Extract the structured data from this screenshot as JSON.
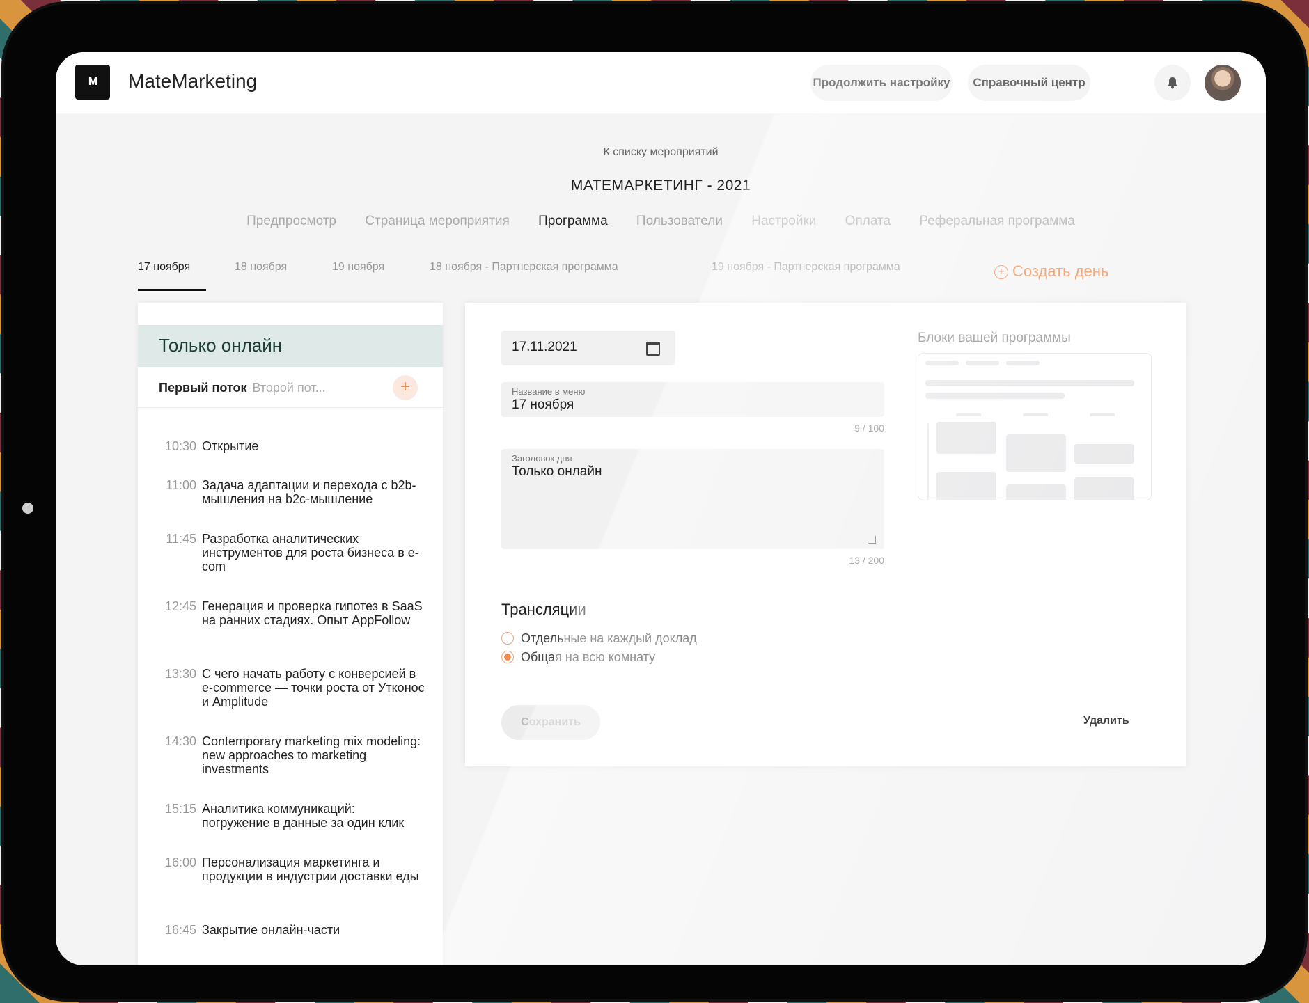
{
  "app": {
    "logo_text": "M",
    "brand": "MateMarketing",
    "continue_setup": "Продолжить настройку",
    "help_center": "Справочный центр",
    "bell_icon": "bell-icon",
    "avatar_icon": "user-avatar"
  },
  "event": {
    "back_link": "К списку мероприятий",
    "title": "МАТЕМАРКЕТИНГ - 2021"
  },
  "nav": {
    "items": [
      "Предпросмотр",
      "Страница мероприятия",
      "Программа",
      "Пользователи",
      "Настройки",
      "Оплата",
      "Реферальная программа"
    ],
    "active": "Программа"
  },
  "days": {
    "tabs": [
      "17 ноября",
      "18 ноября",
      "19 ноября",
      "18 ноября - Партнерская программа",
      "19 ноября - Партнерская программа"
    ],
    "active": "17 ноября",
    "create_day": "Создать день"
  },
  "room": {
    "title": "Только онлайн",
    "stream_active": "Первый поток",
    "stream_inactive": "Второй пот..."
  },
  "sessions": [
    {
      "time": "10:30",
      "title": "Открытие"
    },
    {
      "time": "11:00",
      "title": "Задача адаптации и перехода с b2b-мышления на b2c-мышление"
    },
    {
      "time": "11:45",
      "title": "Разработка аналитических инструментов для роста бизнеса в e-com"
    },
    {
      "time": "12:45",
      "title": "Генерация и проверка гипотез в SaaS на ранних стадиях. Опыт AppFollow"
    },
    {
      "time": "13:30",
      "title": "С чего начать работу с конверсией в e-commerce — точки роста от Утконос и Amplitude"
    },
    {
      "time": "14:30",
      "title": "Contemporary marketing mix modeling: new approaches to marketing investments"
    },
    {
      "time": "15:15",
      "title": "Аналитика коммуникаций: погружение в данные за один клик"
    },
    {
      "time": "16:00",
      "title": "Персонализация маркетинга и продукции в индустрии доставки еды"
    },
    {
      "time": "16:45",
      "title": "Закрытие онлайн-части"
    }
  ],
  "form": {
    "date_value": "17.11.2021",
    "menu_name_label": "Название в меню",
    "menu_name_value": "17 ноября",
    "menu_name_counter": "9 / 100",
    "day_title_label": "Заголовок дня",
    "day_title_value": "Только онлайн",
    "day_title_counter": "13 / 200",
    "broadcasts_title": "Трансляции",
    "radio_options": [
      "Отдельные на каждый доклад",
      "Общая на всю комнату"
    ],
    "radio_selected": "Общая на всю комнату",
    "save_label": "Сохранить",
    "delete_label": "Удалить",
    "blocks_title": "Блоки вашей программы"
  },
  "colors": {
    "accent": "#f08a4f",
    "room_bg": "#dfe9e8",
    "room_text": "#1c3e37"
  }
}
